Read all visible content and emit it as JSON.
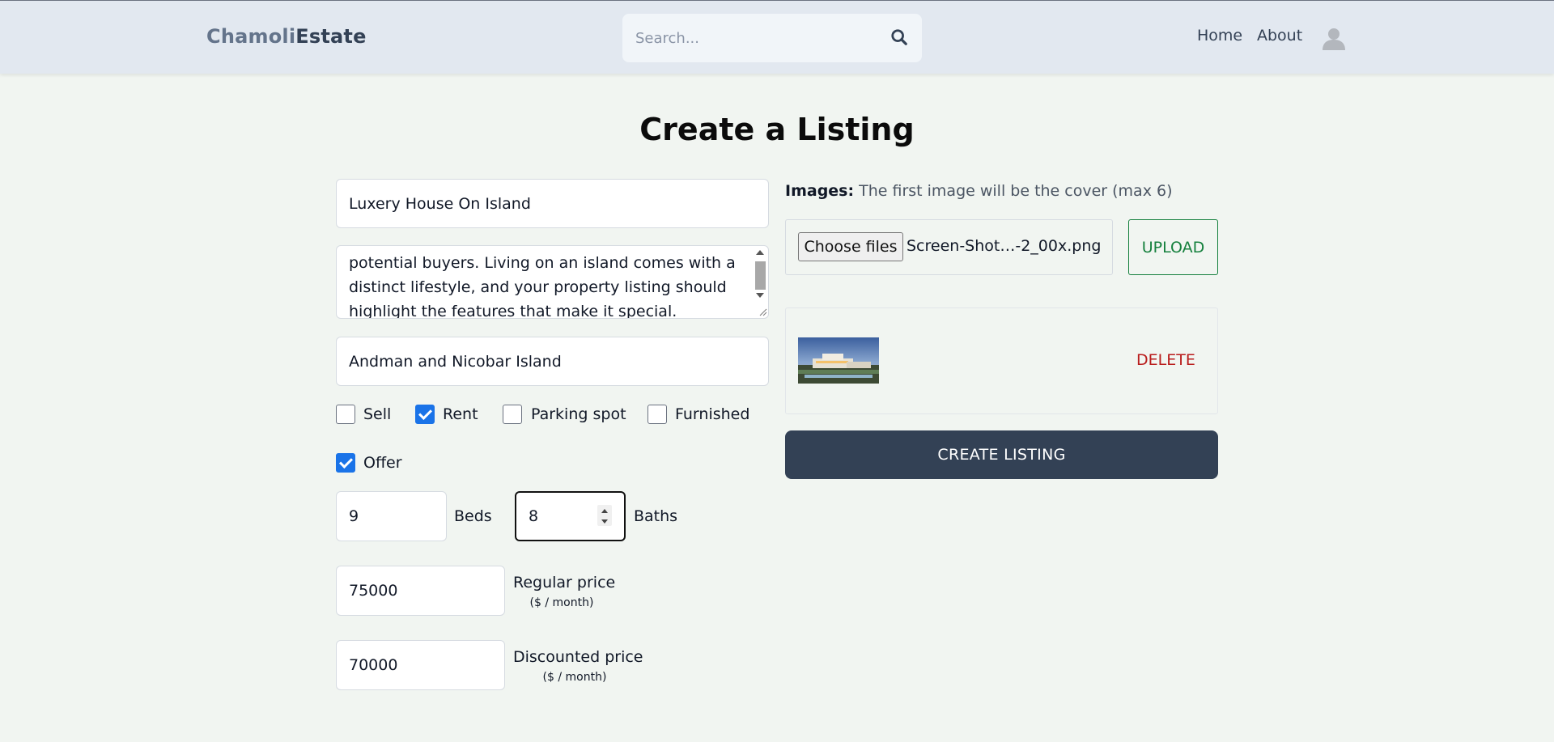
{
  "header": {
    "logo_part1": "Chamoli",
    "logo_part2": "Estate",
    "search_placeholder": "Search...",
    "nav": {
      "home": "Home",
      "about": "About"
    }
  },
  "page": {
    "title": "Create a Listing"
  },
  "form": {
    "name_value": "Luxery House On Island",
    "description_visible_text": "potential buyers. Living on an island comes with a distinct lifestyle, and your property listing should highlight the features that make it special.",
    "address_value": "Andman and Nicobar Island",
    "checkboxes": {
      "sell": {
        "label": "Sell",
        "checked": false
      },
      "rent": {
        "label": "Rent",
        "checked": true
      },
      "parking": {
        "label": "Parking spot",
        "checked": false
      },
      "furnished": {
        "label": "Furnished",
        "checked": false
      },
      "offer": {
        "label": "Offer",
        "checked": true
      }
    },
    "beds": {
      "value": "9",
      "label": "Beds"
    },
    "baths": {
      "value": "8",
      "label": "Baths"
    },
    "regular_price": {
      "value": "75000",
      "label": "Regular price",
      "unit": "($ / month)"
    },
    "discounted_price": {
      "value": "70000",
      "label": "Discounted price",
      "unit": "($ / month)"
    }
  },
  "images": {
    "label": "Images:",
    "hint": "The first image will be the cover (max 6)",
    "choose_files_label": "Choose files",
    "selected_file_name": "Screen-Shot…-2_00x.png",
    "upload_label": "UPLOAD",
    "delete_label": "DELETE"
  },
  "actions": {
    "create_label": "CREATE LISTING"
  },
  "colors": {
    "background": "#f1f5f1",
    "header": "#e2e8f0",
    "checkbox_accent": "#1a73e8",
    "upload_green": "#15803d",
    "delete_red": "#b91c1c",
    "primary_button": "#334155"
  },
  "icons": [
    "search-icon",
    "user-avatar-icon"
  ]
}
